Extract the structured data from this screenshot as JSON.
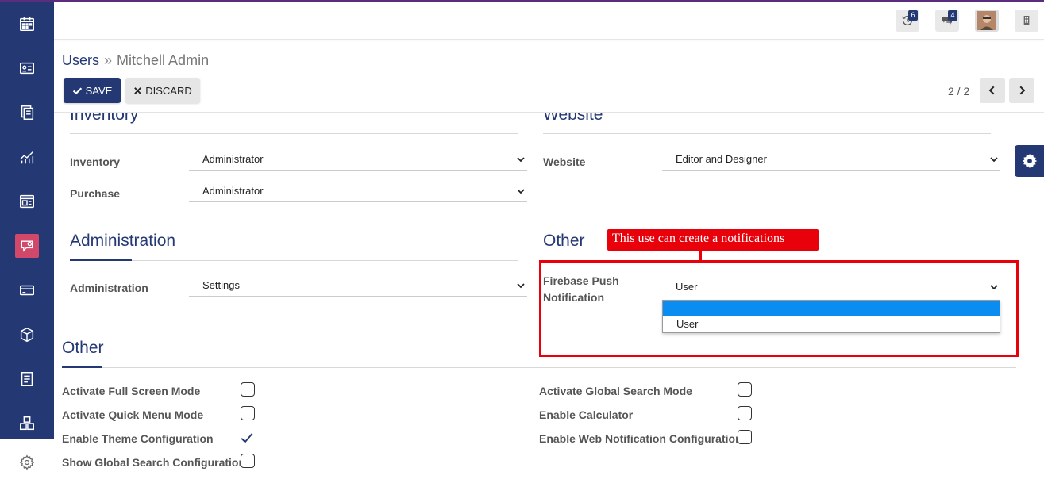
{
  "topnav": {
    "activity_count": "6",
    "messages_count": "4"
  },
  "breadcrumb": {
    "parent": "Users",
    "separator": "»",
    "current": "Mitchell Admin"
  },
  "toolbar": {
    "save_label": "SAVE",
    "discard_label": "DISCARD",
    "pager": "2 / 2"
  },
  "sections": {
    "inventory": {
      "title": "Inventory",
      "fields": [
        {
          "label": "Inventory",
          "value": "Administrator"
        },
        {
          "label": "Purchase",
          "value": "Administrator"
        }
      ]
    },
    "website": {
      "title": "Website",
      "fields": [
        {
          "label": "Website",
          "value": "Editor and Designer"
        }
      ]
    },
    "administration": {
      "title": "Administration",
      "fields": [
        {
          "label": "Administration",
          "value": "Settings"
        }
      ]
    },
    "other_right": {
      "title": "Other",
      "fields": [
        {
          "label_line1": "Firebase Push",
          "label_line2": "Notification",
          "value": "User"
        }
      ],
      "dropdown_options": [
        "",
        "User"
      ]
    },
    "other_bottom": {
      "title": "Other",
      "left_options": [
        {
          "label": "Activate Full Screen Mode",
          "checked": false
        },
        {
          "label": "Activate Quick Menu Mode",
          "checked": false
        },
        {
          "label": "Enable Theme Configuration",
          "checked": true
        },
        {
          "label": "Show Global Search Configuration",
          "checked": false
        }
      ],
      "right_options": [
        {
          "label": "Activate Global Search Mode",
          "checked": false
        },
        {
          "label": "Enable Calculator",
          "checked": false
        },
        {
          "label": "Enable Web Notification Configuration",
          "checked": false
        }
      ]
    }
  },
  "annotation": {
    "text": "This use can create a notifications"
  },
  "colors": {
    "brand": "#243874",
    "annotation": "#e8000b",
    "dropdown_highlight": "#0a8cf0"
  }
}
